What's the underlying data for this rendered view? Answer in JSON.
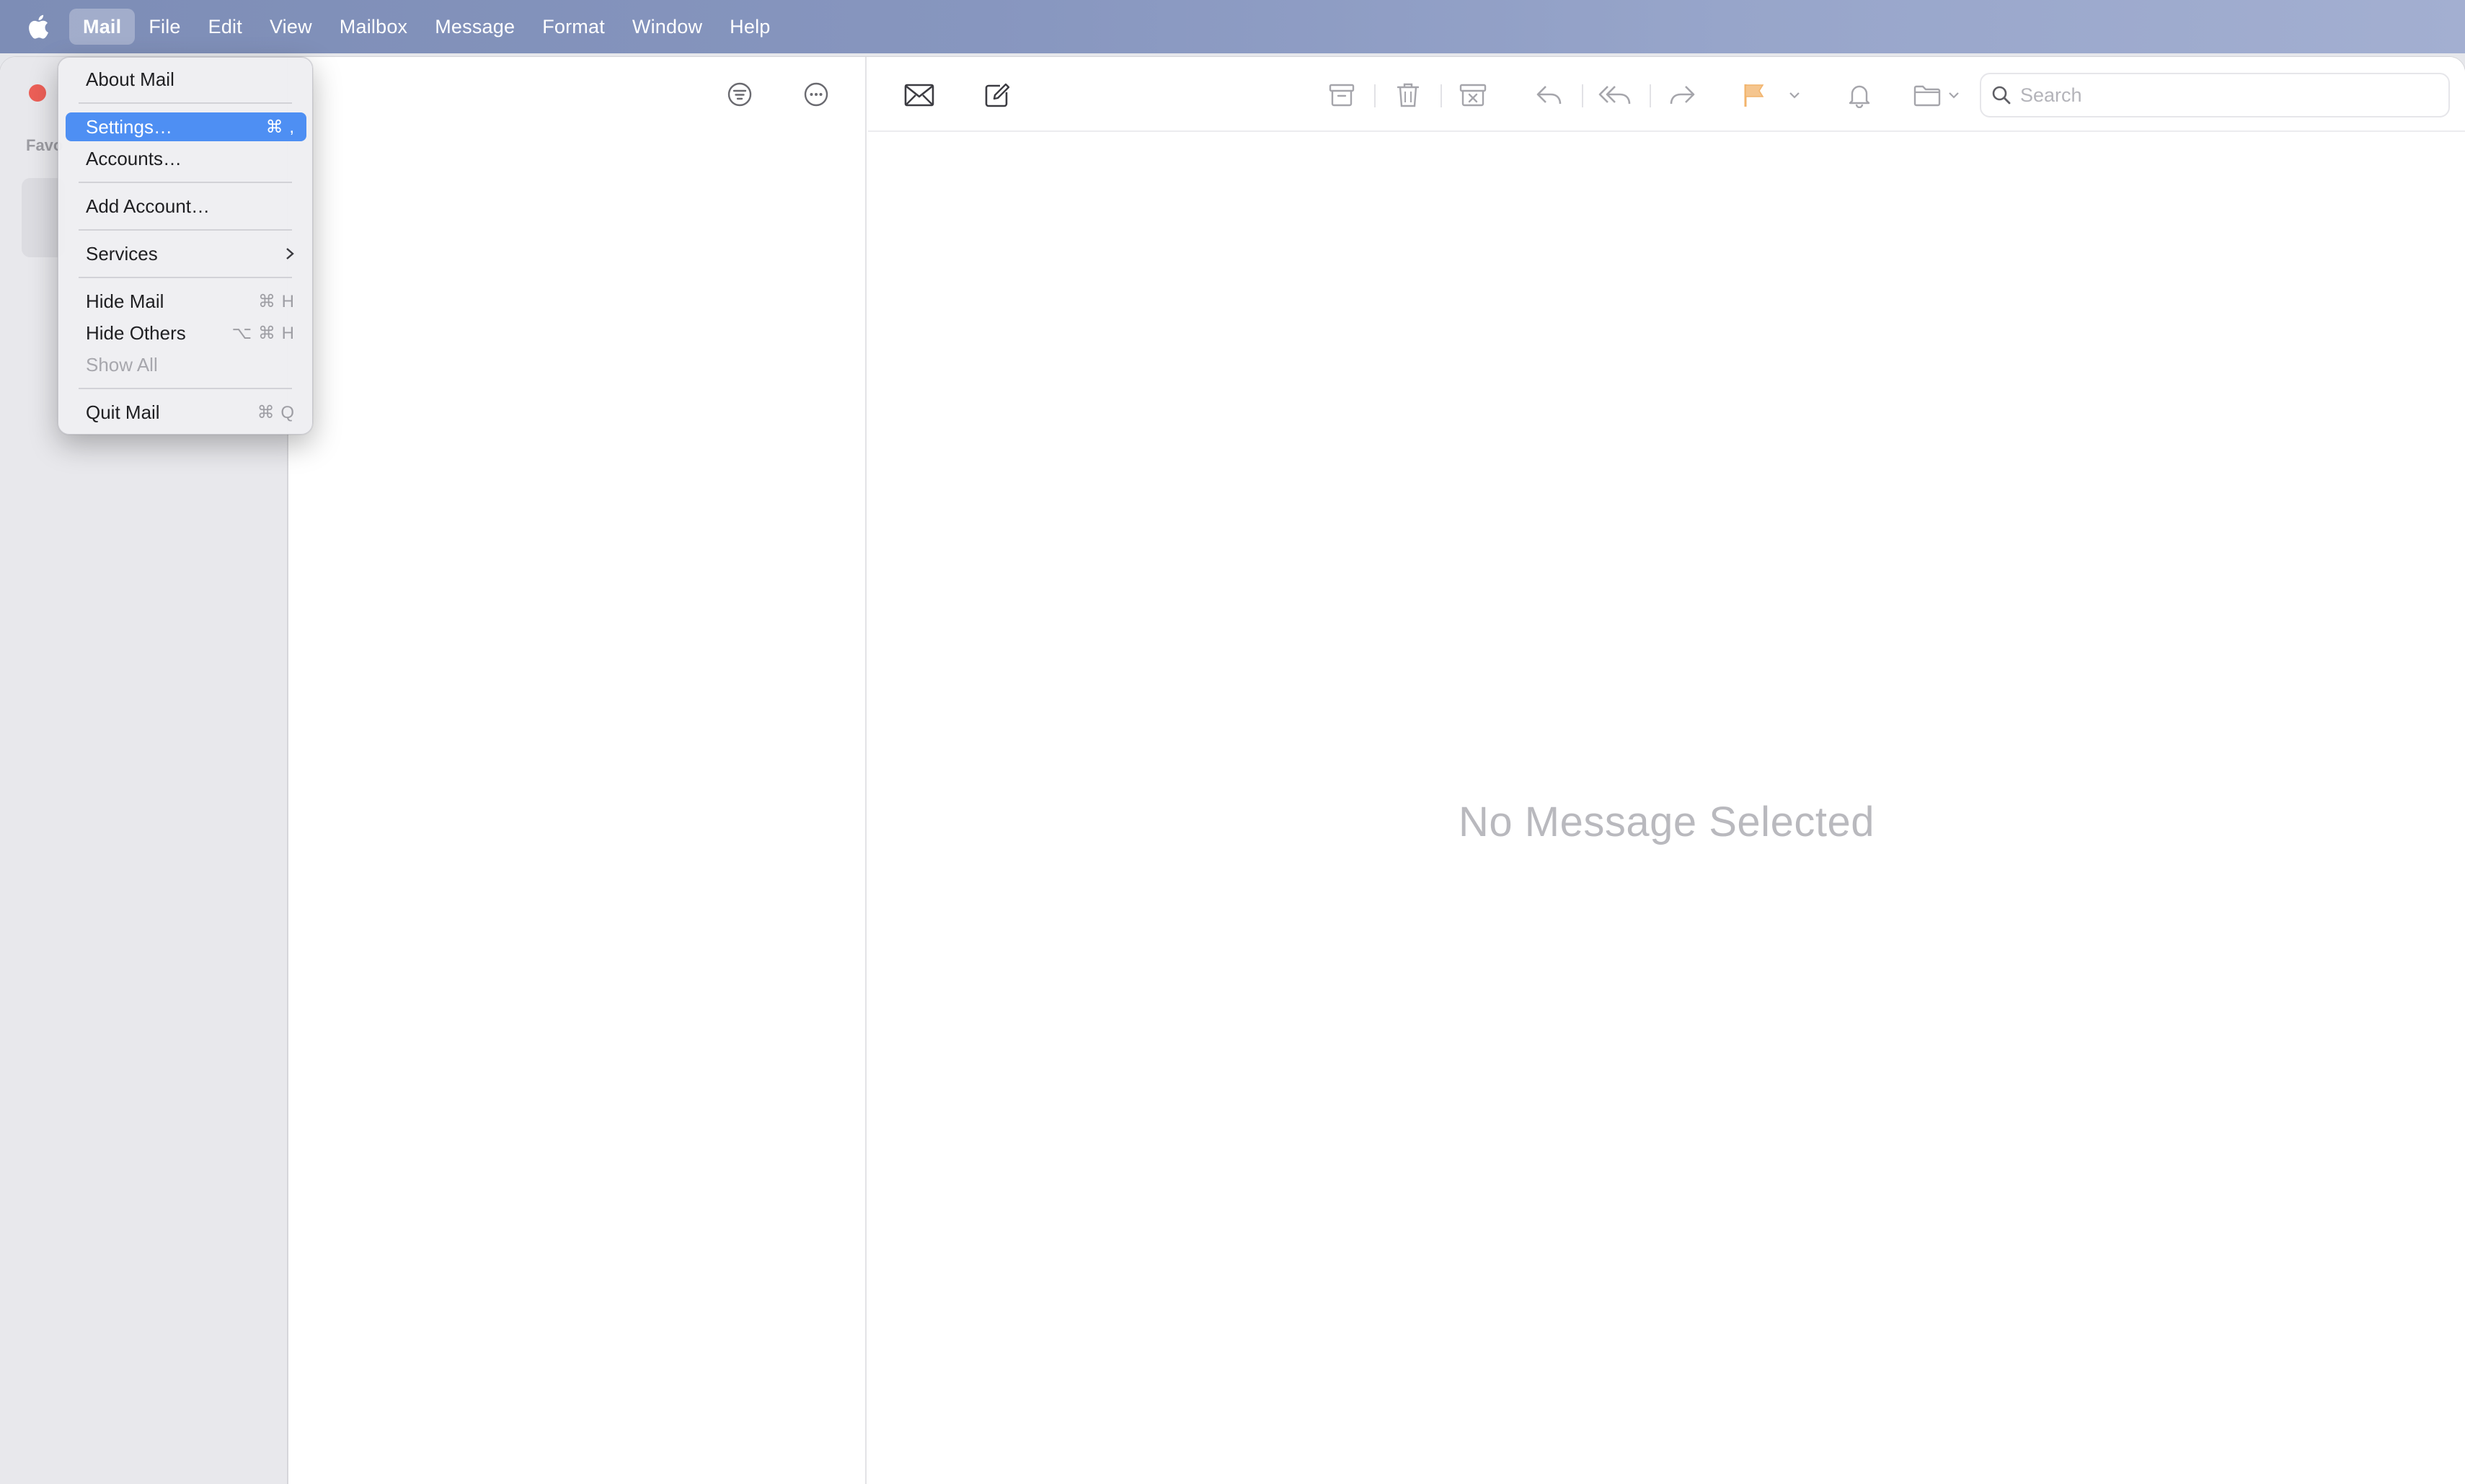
{
  "menubar": {
    "apple_icon": "apple-icon",
    "items": [
      {
        "label": "Mail",
        "active": true
      },
      {
        "label": "File"
      },
      {
        "label": "Edit"
      },
      {
        "label": "View"
      },
      {
        "label": "Mailbox"
      },
      {
        "label": "Message"
      },
      {
        "label": "Format"
      },
      {
        "label": "Window"
      },
      {
        "label": "Help"
      }
    ]
  },
  "mail_menu": {
    "about": "About Mail",
    "settings": {
      "label": "Settings…",
      "shortcut": "⌘ ,"
    },
    "accounts": "Accounts…",
    "add_account": "Add Account…",
    "services": "Services",
    "hide_mail": {
      "label": "Hide Mail",
      "shortcut": "⌘ H"
    },
    "hide_others": {
      "label": "Hide Others",
      "shortcut": "⌥ ⌘ H"
    },
    "show_all": "Show All",
    "quit": {
      "label": "Quit Mail",
      "shortcut": "⌘ Q"
    }
  },
  "sidebar": {
    "section_label": "Favo"
  },
  "toolbar": {
    "search_placeholder": "Search",
    "icons": [
      "filter-icon",
      "more-icon",
      "get-mail-icon",
      "compose-icon",
      "archive-icon",
      "trash-icon",
      "junk-icon",
      "reply-icon",
      "reply-all-icon",
      "forward-icon",
      "flag-icon",
      "bell-icon",
      "move-to-folder-icon",
      "search-icon"
    ],
    "flag_color": "#f2b36b"
  },
  "viewer": {
    "empty_message": "No Message Selected"
  }
}
